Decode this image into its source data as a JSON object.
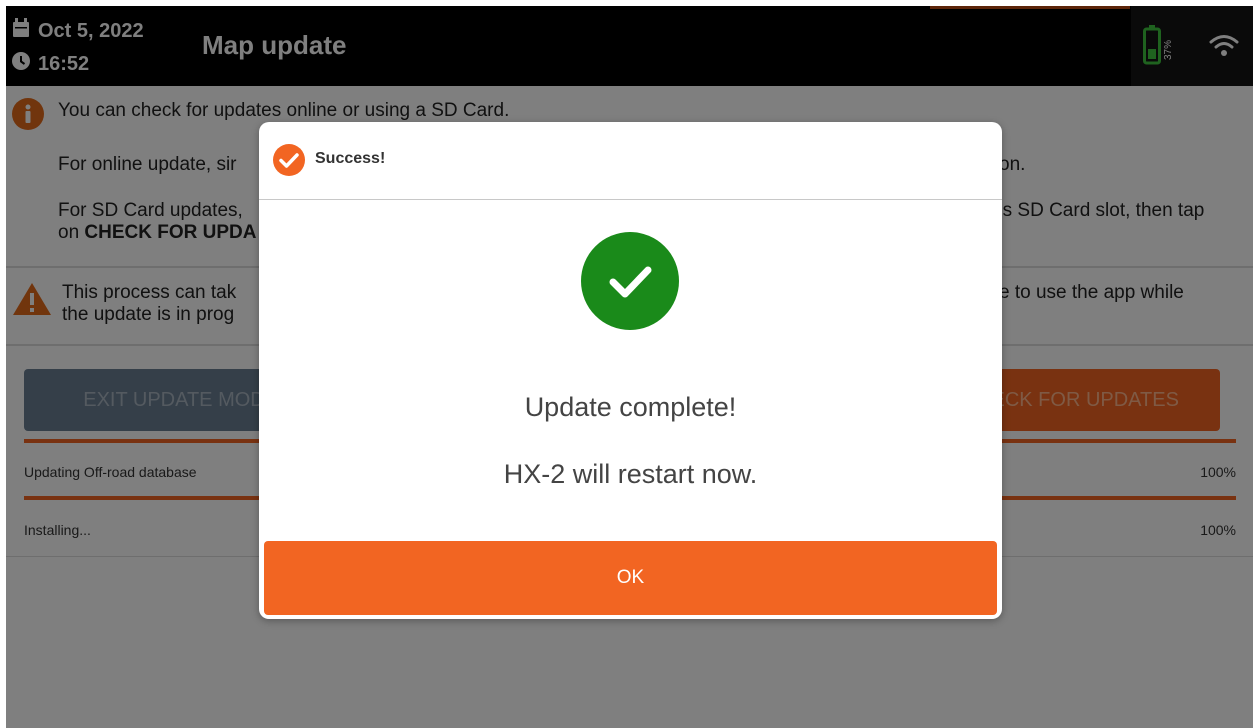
{
  "header": {
    "date": "Oct 5, 2022",
    "time": "16:52",
    "title": "Map update",
    "battery_percent": "37%",
    "icons": [
      "calendar-icon",
      "clock-icon",
      "battery-icon",
      "wifi-icon"
    ]
  },
  "content": {
    "info_line": "You can check for updates online or using a SD Card.",
    "online_text": "For online update, sir",
    "online_text_tail": "on.",
    "sd_text_start": "For SD Card updates,",
    "sd_text_tail": "'s SD Card slot, then tap",
    "sd_text_bold": "CHECK FOR UPDA",
    "sd_text_prefix": "on ",
    "warning_text_1": "This process can tak",
    "warning_text_1_tail": "e to use the app while",
    "warning_text_2": "the update is in prog",
    "exit_button": "EXIT UPDATE MOD",
    "check_button": "HECK FOR UPDATES",
    "progress": [
      {
        "label": "Updating Off-road database",
        "value": "100%",
        "fraction": 1.0
      },
      {
        "label": "Installing...",
        "value": "100%",
        "fraction": 1.0
      }
    ]
  },
  "dialog": {
    "title": "Success!",
    "message_1": "Update complete!",
    "message_2": "HX-2 will restart now.",
    "ok_label": "OK"
  },
  "colors": {
    "accent": "#f26522",
    "success_green": "#1a8a1a",
    "battery_green": "#3ec43e",
    "info_orange": "#e26a1a"
  }
}
